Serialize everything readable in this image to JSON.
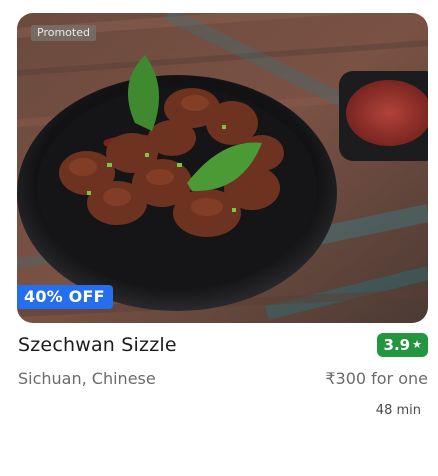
{
  "card": {
    "promoted_label": "Promoted",
    "discount_label": "40% OFF",
    "name": "Szechwan Sizzle",
    "rating": "3.9",
    "rating_icon": "star-icon",
    "cuisine": "Sichuan, Chinese",
    "price": "₹300 for one",
    "delivery_time": "48 min"
  },
  "colors": {
    "discount_bg": "#256fef",
    "rating_bg": "#24963f",
    "name_text": "#1c1c1c",
    "secondary_text": "#6b6b6b"
  }
}
